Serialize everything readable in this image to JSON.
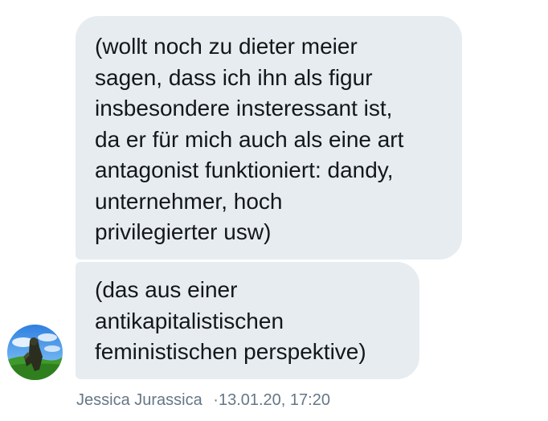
{
  "messages": [
    {
      "text": "(wollt noch zu dieter meier\nsagen, dass ich ihn als figur\ninsbesondere insteressant ist,\nda er für mich auch als eine art\nantagonist funktioniert: dandy,\nunternehmer, hoch\nprivilegierter usw)"
    },
    {
      "text": "(das aus einer\nantikapitalistischen\nfeministischen perspektive)"
    }
  ],
  "sender": {
    "name": "Jessica Jurassica",
    "timestamp": "13.01.20, 17:20",
    "separator": "·"
  },
  "colors": {
    "bubble_bg": "#e6ecf0",
    "bubble_text": "#14171a",
    "meta_text": "#657786"
  },
  "icons": {
    "avatar": "avatar-photo"
  }
}
